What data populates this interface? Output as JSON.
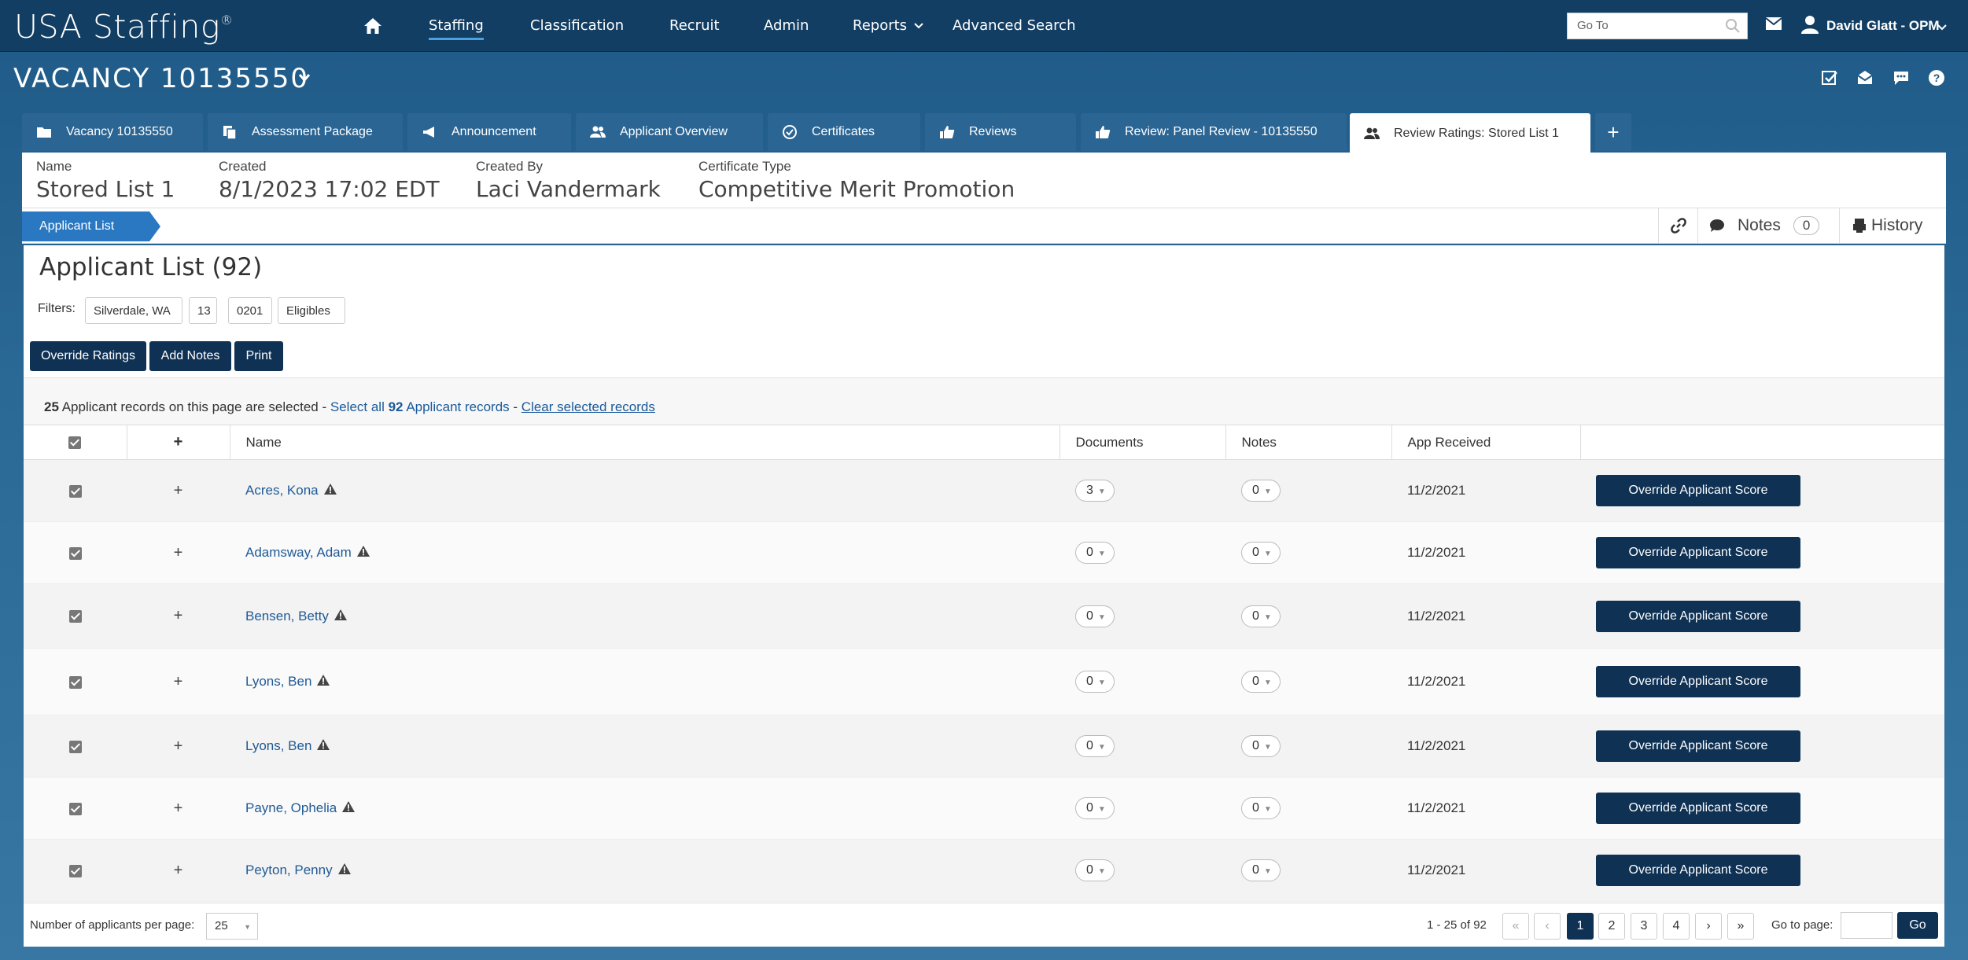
{
  "app": {
    "logo_text": "USA Staffing",
    "logo_mark": "®"
  },
  "topnav": {
    "items": [
      {
        "label": "Staffing",
        "active": true
      },
      {
        "label": "Classification"
      },
      {
        "label": "Recruit"
      },
      {
        "label": "Admin"
      },
      {
        "label": "Reports"
      },
      {
        "label": "Advanced Search"
      }
    ],
    "goto_placeholder": "Go To",
    "user_name": "David Glatt - OPM"
  },
  "vacancy": {
    "title": "VACANCY 10135550"
  },
  "tabs": [
    {
      "label": "Vacancy 10135550",
      "icon": "folder-icon"
    },
    {
      "label": "Assessment Package",
      "icon": "copy-icon"
    },
    {
      "label": "Announcement",
      "icon": "megaphone-icon"
    },
    {
      "label": "Applicant Overview",
      "icon": "users-icon"
    },
    {
      "label": "Certificates",
      "icon": "check-circle-icon"
    },
    {
      "label": "Reviews",
      "icon": "thumbs-up-icon"
    },
    {
      "label": "Review: Panel Review - 10135550",
      "icon": "thumbs-up-icon"
    },
    {
      "label": "Review Ratings: Stored List 1",
      "icon": "users-icon",
      "active": true
    },
    {
      "label": "+",
      "icon": "plus-icon"
    }
  ],
  "info": {
    "name_label": "Name",
    "name_value": "Stored List 1",
    "created_label": "Created",
    "created_value": "8/1/2023 17:02 EDT",
    "created_by_label": "Created By",
    "created_by_value": "Laci Vandermark",
    "cert_type_label": "Certificate Type",
    "cert_type_value": "Competitive Merit Promotion"
  },
  "strip": {
    "crumb": "Applicant List",
    "notes_label": "Notes",
    "notes_count": "0",
    "history_label": "History"
  },
  "panel": {
    "title": "Applicant List (92)",
    "filters_label": "Filters:",
    "filters": [
      "Silverdale, WA",
      "13",
      "0201",
      "Eligibles"
    ],
    "buttons": {
      "override": "Override Ratings",
      "add_notes": "Add Notes",
      "print": "Print"
    },
    "selection": {
      "count": "25",
      "text1": "Applicant records on this page are selected -",
      "select_all_prefix": "Select all",
      "total": "92",
      "select_all_suffix": "Applicant records",
      "sep": "-",
      "clear": "Clear selected records"
    }
  },
  "table": {
    "headers": {
      "plus": "+",
      "name": "Name",
      "documents": "Documents",
      "notes": "Notes",
      "app_received": "App Received"
    },
    "rows": [
      {
        "name": "Acres, Kona",
        "documents": "3",
        "notes": "0",
        "app_received": "11/2/2021",
        "action": "Override Applicant Score"
      },
      {
        "name": "Adamsway, Adam",
        "documents": "0",
        "notes": "0",
        "app_received": "11/2/2021",
        "action": "Override Applicant Score"
      },
      {
        "name": "Bensen, Betty",
        "documents": "0",
        "notes": "0",
        "app_received": "11/2/2021",
        "action": "Override Applicant Score"
      },
      {
        "name": "Lyons, Ben",
        "documents": "0",
        "notes": "0",
        "app_received": "11/2/2021",
        "action": "Override Applicant Score"
      },
      {
        "name": "Lyons, Ben",
        "documents": "0",
        "notes": "0",
        "app_received": "11/2/2021",
        "action": "Override Applicant Score"
      },
      {
        "name": "Payne, Ophelia",
        "documents": "0",
        "notes": "0",
        "app_received": "11/2/2021",
        "action": "Override Applicant Score"
      },
      {
        "name": "Peyton, Penny",
        "documents": "0",
        "notes": "0",
        "app_received": "11/2/2021",
        "action": "Override Applicant Score"
      }
    ]
  },
  "footer": {
    "per_page_label": "Number of applicants per page:",
    "per_page_value": "25",
    "range": "1 - 25 of 92",
    "pages": [
      "1",
      "2",
      "3",
      "4"
    ],
    "first": "«",
    "prev": "‹",
    "next": "›",
    "last": "»",
    "goto_label": "Go to page:",
    "goto_button": "Go"
  },
  "colors": {
    "nav": "#123e63",
    "accent": "#2a78c2",
    "button": "#0f3154",
    "link": "#1f5a96"
  }
}
